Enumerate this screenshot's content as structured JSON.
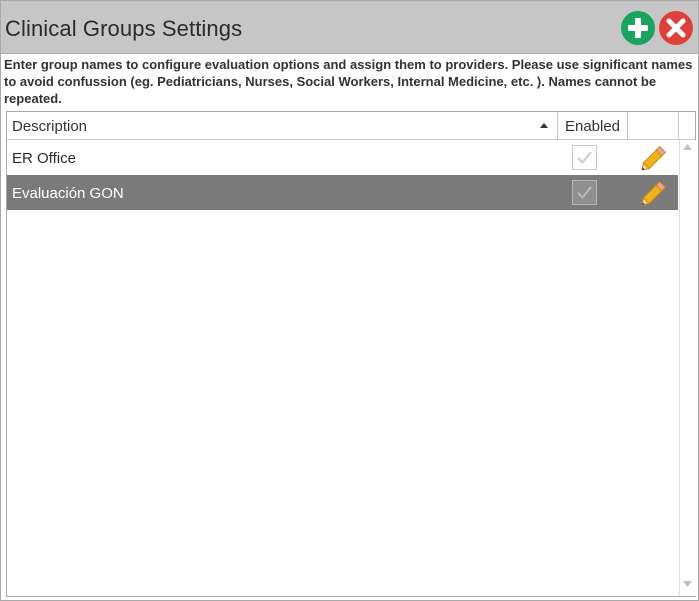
{
  "window": {
    "title": "Clinical Groups Settings",
    "add_icon": "plus-circle-icon",
    "close_icon": "x-circle-icon"
  },
  "instructions": "Enter group names to configure evaluation options and assign them to providers. Please use significant names to avoid confussion (eg. Pediatricians, Nurses, Social Workers, Internal Medicine, etc. ). Names cannot be repeated.",
  "grid": {
    "columns": {
      "description": "Description",
      "enabled": "Enabled"
    },
    "sort": {
      "column": "Description",
      "direction": "ascending"
    },
    "rows": [
      {
        "description": "ER Office",
        "enabled": true,
        "selected": false
      },
      {
        "description": "Evaluación GON",
        "enabled": true,
        "selected": true
      }
    ]
  },
  "colors": {
    "titlebar": "#c6c6c6",
    "add_button": "#1aa45f",
    "close_button": "#e0403a",
    "selected_row": "#7a7a7a",
    "edit_pencil": "#f2b21a"
  }
}
